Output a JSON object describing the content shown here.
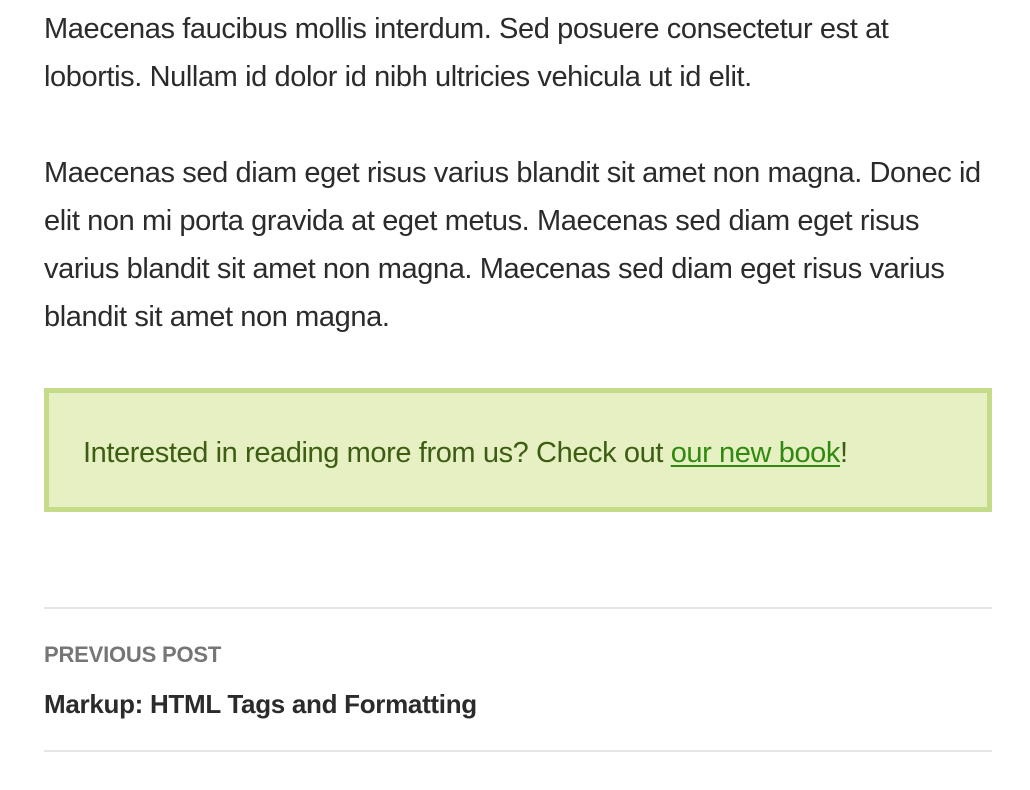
{
  "article": {
    "paragraphs": [
      "Maecenas faucibus mollis interdum. Sed posuere consectetur est at lobortis. Nullam id dolor id nibh ultricies vehicula ut id elit.",
      "Maecenas sed diam eget risus varius blandit sit amet non magna. Donec id elit non mi porta gravida at eget metus. Maecenas sed diam eget risus varius blandit sit amet non magna. Maecenas sed diam eget risus varius blandit sit amet non magna."
    ]
  },
  "promo": {
    "text_before": "Interested in reading more from us? Check out ",
    "link_text": "our new book",
    "text_after": "!"
  },
  "post_navigation": {
    "label": "Previous Post",
    "title": "Markup: HTML Tags and Formatting"
  },
  "colors": {
    "promo_border": "#c4dc8a",
    "promo_background": "#e6f0c3",
    "promo_text": "#3d5e12",
    "link": "#2f8a0f"
  }
}
